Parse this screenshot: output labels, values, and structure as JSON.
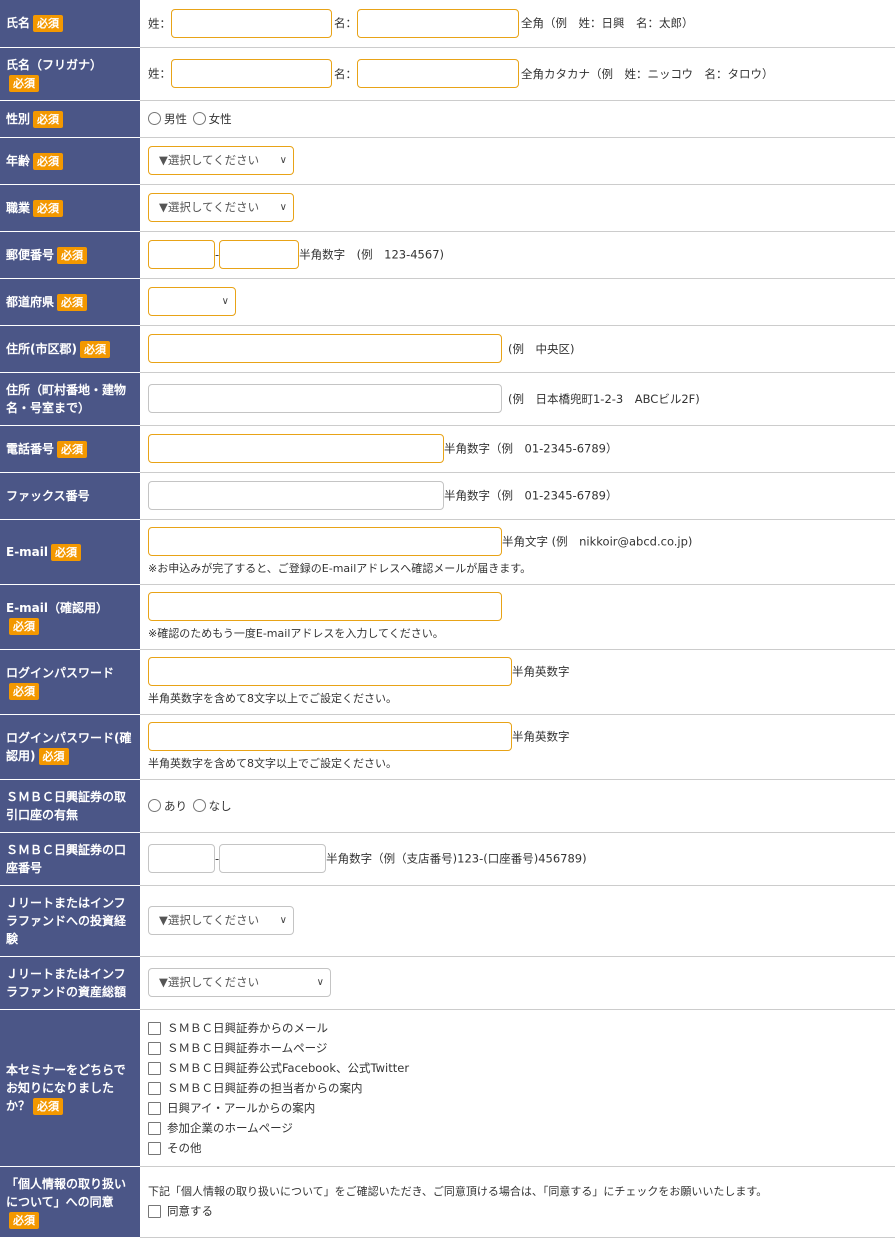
{
  "required": "必須",
  "rows": {
    "name": {
      "label": "氏名",
      "sei": "姓：",
      "mei": "名：",
      "hint": "全角（例　姓：日興　名：太郎）"
    },
    "kana": {
      "label": "氏名（フリガナ）",
      "sei": "姓：",
      "mei": "名：",
      "hint": "全角カタカナ（例　姓：ニッコウ　名：タロウ）"
    },
    "gender": {
      "label": "性別",
      "options": [
        "男性",
        "女性"
      ]
    },
    "age": {
      "label": "年齢",
      "select": "▼選択してください"
    },
    "job": {
      "label": "職業",
      "select": "▼選択してください"
    },
    "zip": {
      "label": "郵便番号",
      "dash": "-",
      "hint": "半角数字　(例　123-4567)"
    },
    "pref": {
      "label": "都道府県"
    },
    "city": {
      "label": "住所(市区郡)",
      "hint": "(例　中央区)"
    },
    "address": {
      "label": "住所（町村番地・建物名・号室まで）",
      "hint": "(例　日本橋兜町1-2-3　ABCビル2F)"
    },
    "tel": {
      "label": "電話番号",
      "hint": "半角数字（例　01-2345-6789）"
    },
    "fax": {
      "label": "ファックス番号",
      "hint": "半角数字（例　01-2345-6789）"
    },
    "email": {
      "label": "E-mail",
      "hint": "半角文字 (例　nikkoir@abcd.co.jp)",
      "note": "※お申込みが完了すると、ご登録のE-mailアドレスへ確認メールが届きます。"
    },
    "email2": {
      "label": "E-mail（確認用）",
      "note": "※確認のためもう一度E-mailアドレスを入力してください。"
    },
    "pw": {
      "label": "ログインパスワード",
      "hint": "半角英数字",
      "note": "半角英数字を含めて8文字以上でご設定ください。"
    },
    "pw2": {
      "label": "ログインパスワード(確認用)",
      "hint": "半角英数字",
      "note": "半角英数字を含めて8文字以上でご設定ください。"
    },
    "account": {
      "label": "ＳＭＢＣ日興証券の取引口座の有無",
      "options": [
        "あり",
        "なし"
      ]
    },
    "accno": {
      "label": "ＳＭＢＣ日興証券の口座番号",
      "dash": "-",
      "hint": "半角数字（例（支店番号)123-(口座番号)456789)"
    },
    "reitexp": {
      "label": "Ｊリートまたはインフラファンドへの投資経験",
      "select": "▼選択してください"
    },
    "reitasset": {
      "label": "Ｊリートまたはインフラファンドの資産総額",
      "select": "▼選択してください"
    },
    "source": {
      "label": "本セミナーをどちらでお知りになりましたか？",
      "options": [
        "ＳＭＢＣ日興証券からのメール",
        "ＳＭＢＣ日興証券ホームページ",
        "ＳＭＢＣ日興証券公式Facebook、公式Twitter",
        "ＳＭＢＣ日興証券の担当者からの案内",
        "日興アイ・アールからの案内",
        "参加企業のホームページ",
        "その他"
      ]
    },
    "privacy": {
      "label": "「個人情報の取り扱いについて」への同意",
      "text": "下記「個人情報の取り扱いについて」をご確認いただき、ご同意頂ける場合は、「同意する」にチェックをお願いいたします。",
      "agree": "同意する"
    }
  }
}
